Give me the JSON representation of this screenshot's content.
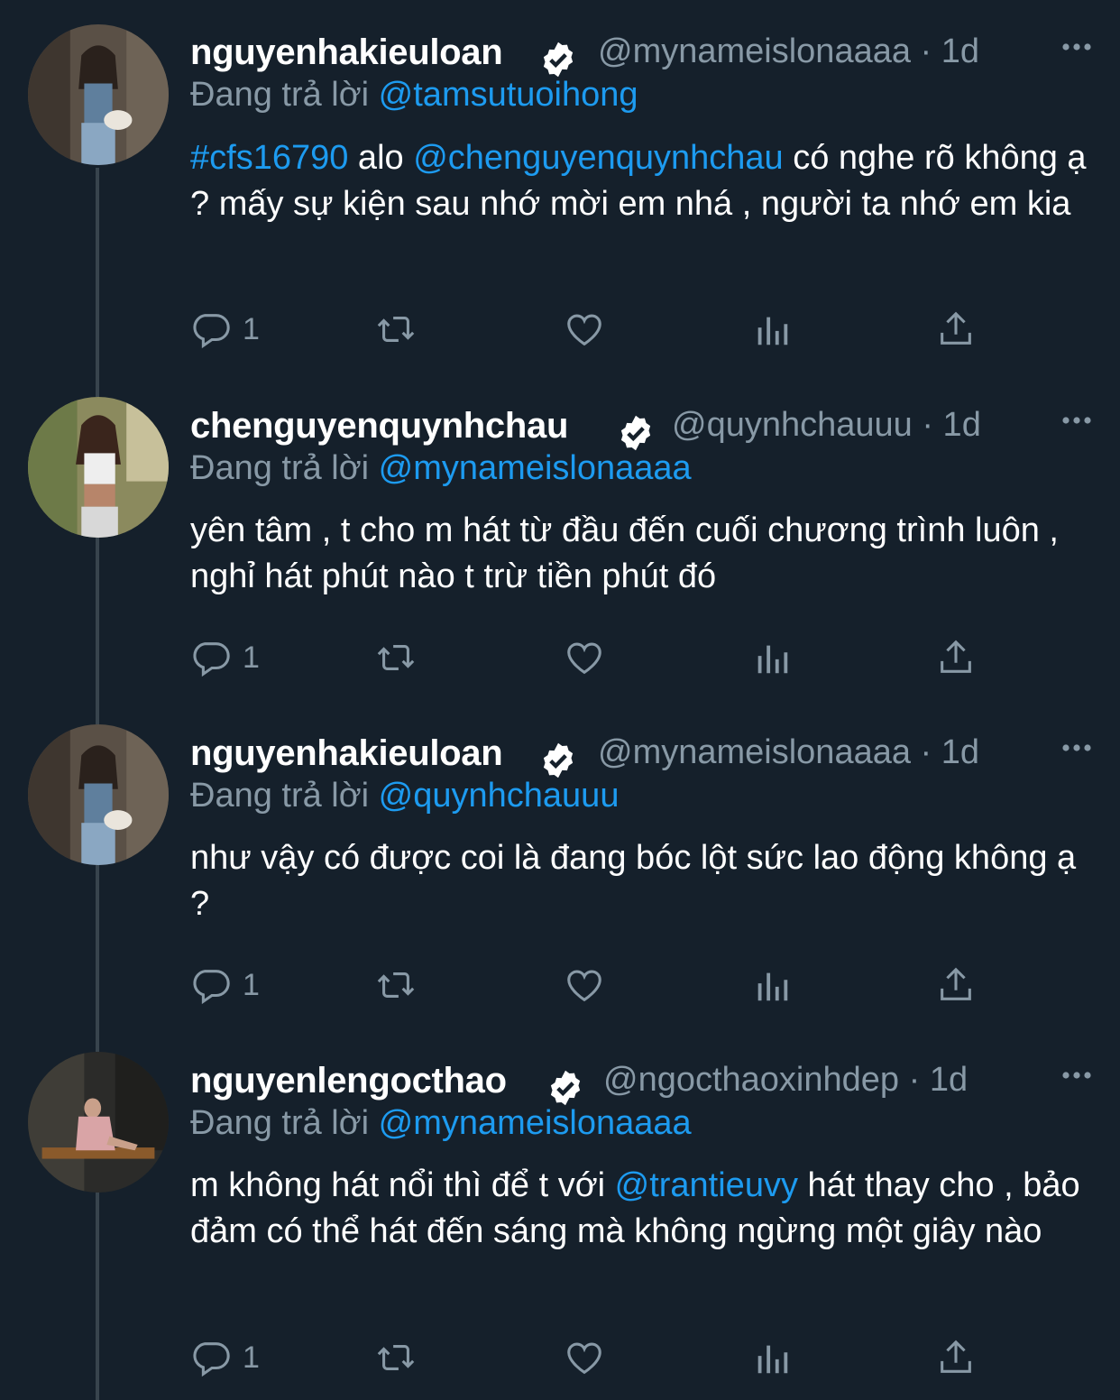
{
  "colors": {
    "background": "#15202b",
    "link": "#1d9bf0",
    "muted": "#8899a6",
    "verified": "#ffffff"
  },
  "replying_label": "Đang trả lời",
  "tweets": [
    {
      "name": "nguyenhakieuloan",
      "handle": "@mynameislonaaaa",
      "time": "· 1d",
      "replying_to": "@tamsutuoihong",
      "body": [
        {
          "t": "#cfs16790",
          "link": true
        },
        {
          "t": " alo ",
          "link": false
        },
        {
          "t": "@chenguyenquynhchau",
          "link": true
        },
        {
          "t": " có nghe rõ không ạ ? mấy sự kiện sau nhớ mời em nhá , người ta nhớ em kia",
          "link": false
        }
      ],
      "reply_count": "1",
      "icons": [
        "reply-icon",
        "retweet-icon",
        "like-icon",
        "analytics-icon",
        "share-icon"
      ]
    },
    {
      "name": "chenguyenquynhchau",
      "handle": "@quynhchauuu",
      "time": "· 1d",
      "replying_to": "@mynameislonaaaa",
      "body": [
        {
          "t": "yên tâm , t cho m hát từ đầu đến cuối chương trình luôn , nghỉ hát phút nào t trừ tiền phút đó",
          "link": false
        }
      ],
      "reply_count": "1",
      "icons": [
        "reply-icon",
        "retweet-icon",
        "like-icon",
        "analytics-icon",
        "share-icon"
      ]
    },
    {
      "name": "nguyenhakieuloan",
      "handle": "@mynameislonaaaa",
      "time": "· 1d",
      "replying_to": "@quynhchauuu",
      "body": [
        {
          "t": "như vậy có được coi là đang bóc lột sức lao động không ạ ?",
          "link": false
        }
      ],
      "reply_count": "1",
      "icons": [
        "reply-icon",
        "retweet-icon",
        "like-icon",
        "analytics-icon",
        "share-icon"
      ]
    },
    {
      "name": "nguyenlengocthao",
      "handle": "@ngocthaoxinhdep",
      "time": "· 1d",
      "replying_to": "@mynameislonaaaa",
      "body": [
        {
          "t": "m không hát nổi thì để t với ",
          "link": false
        },
        {
          "t": "@trantieuvy",
          "link": true
        },
        {
          "t": " hát thay cho , bảo đảm có thể hát đến sáng mà không ngừng một giây nào",
          "link": false
        }
      ],
      "reply_count": "1",
      "icons": [
        "reply-icon",
        "retweet-icon",
        "like-icon",
        "analytics-icon",
        "share-icon"
      ]
    }
  ]
}
